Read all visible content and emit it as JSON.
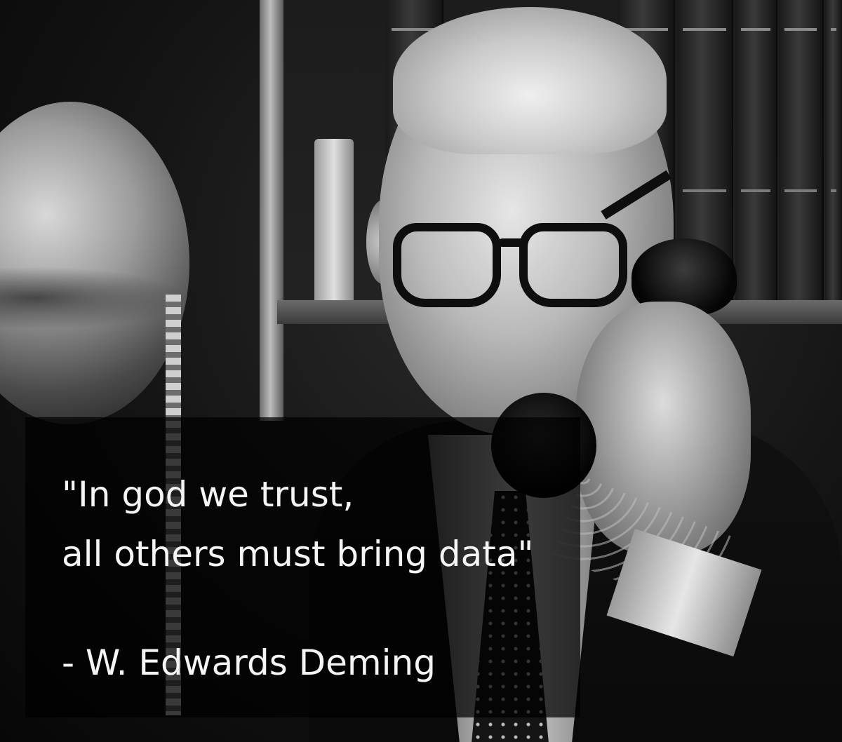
{
  "quote": {
    "line1": "\"In god we trust,",
    "line2": "all others must bring data\"",
    "attribution": "- W. Edwards Deming"
  },
  "colors": {
    "panel_overlay": "#000000",
    "text": "#f5f5f5"
  }
}
